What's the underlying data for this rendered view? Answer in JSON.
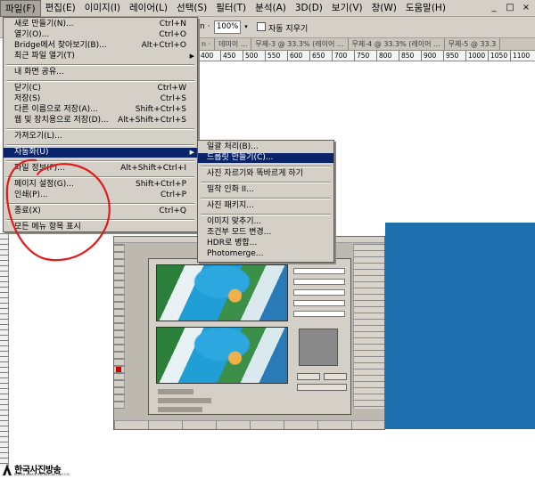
{
  "menubar": {
    "items": [
      {
        "label": "파일(F)",
        "active": true
      },
      {
        "label": "편집(E)"
      },
      {
        "label": "이미지(I)"
      },
      {
        "label": "레이어(L)"
      },
      {
        "label": "선택(S)"
      },
      {
        "label": "필터(T)"
      },
      {
        "label": "분석(A)"
      },
      {
        "label": "3D(D)"
      },
      {
        "label": "보기(V)"
      },
      {
        "label": "창(W)"
      },
      {
        "label": "도움말(H)"
      }
    ],
    "window_controls": [
      "_",
      "□",
      "×"
    ]
  },
  "options_bar": {
    "zoom_label": "n ·",
    "zoom_value": "100%",
    "fit_label": "자동 지우기"
  },
  "document_tabs": [
    "n ·",
    "데미이 ...",
    "무제-3 @ 33.3% (레이어 ...",
    "무제-4 @ 33.3% (레이어 ...",
    "무제-5 @ 33.3"
  ],
  "ruler_ticks": [
    "400",
    "450",
    "500",
    "550",
    "600",
    "650",
    "700",
    "750",
    "800",
    "850",
    "900",
    "950",
    "1000",
    "1050",
    "1100"
  ],
  "file_menu": {
    "items": [
      {
        "label": "새로 만들기(N)...",
        "shortcut": "Ctrl+N"
      },
      {
        "label": "열기(O)...",
        "shortcut": "Ctrl+O"
      },
      {
        "label": "Bridge에서 찾아보기(B)...",
        "shortcut": "Alt+Ctrl+O"
      },
      {
        "label": "최근 파일 열기(T)",
        "shortcut": "",
        "submenu": true
      },
      {
        "separator": true
      },
      {
        "label": "내 화면 공유...",
        "shortcut": ""
      },
      {
        "separator": true
      },
      {
        "label": "닫기(C)",
        "shortcut": "Ctrl+W"
      },
      {
        "label": "저장(S)",
        "shortcut": "Ctrl+S"
      },
      {
        "label": "다른 이름으로 저장(A)...",
        "shortcut": "Shift+Ctrl+S"
      },
      {
        "label": "웹 및 장치용으로 저장(D)...",
        "shortcut": "Alt+Shift+Ctrl+S"
      },
      {
        "separator": true
      },
      {
        "label": "가져오기(L)...",
        "shortcut": ""
      },
      {
        "separator": true
      },
      {
        "label": "자동화(U)",
        "shortcut": "",
        "submenu": true,
        "highlighted": true
      },
      {
        "separator": true
      },
      {
        "label": "파일 정보(F)...",
        "shortcut": "Alt+Shift+Ctrl+I"
      },
      {
        "separator": true
      },
      {
        "label": "페이지 설정(G)...",
        "shortcut": "Shift+Ctrl+P"
      },
      {
        "label": "인쇄(P)...",
        "shortcut": "Ctrl+P"
      },
      {
        "separator": true
      },
      {
        "label": "종료(X)",
        "shortcut": "Ctrl+Q"
      },
      {
        "separator": true
      },
      {
        "label": "모든 메뉴 항목 표시",
        "shortcut": ""
      }
    ]
  },
  "automate_menu": {
    "items": [
      {
        "label": "일괄 처리(B)..."
      },
      {
        "label": "드롭릿 만들기(C)...",
        "highlighted": true
      },
      {
        "separator": true
      },
      {
        "label": "사진 자르기와 똑바르게 하기"
      },
      {
        "separator": true
      },
      {
        "label": "밀착 인화 II..."
      },
      {
        "separator": true
      },
      {
        "label": "사진 패키지..."
      },
      {
        "separator": true
      },
      {
        "label": "이미지 맞추기..."
      },
      {
        "label": "조건부 모드 변경..."
      },
      {
        "label": "HDR로 병합..."
      },
      {
        "label": "Photomerge..."
      }
    ]
  },
  "logo": {
    "name": "한국사진방송",
    "subtitle": "KOREA IMAGE BROADCASTING CO."
  },
  "colors": {
    "menu_face": "#d4d0c8",
    "highlight": "#0a246a",
    "annotation": "#e11b1b",
    "workspace_blue": "#1d6fae"
  }
}
